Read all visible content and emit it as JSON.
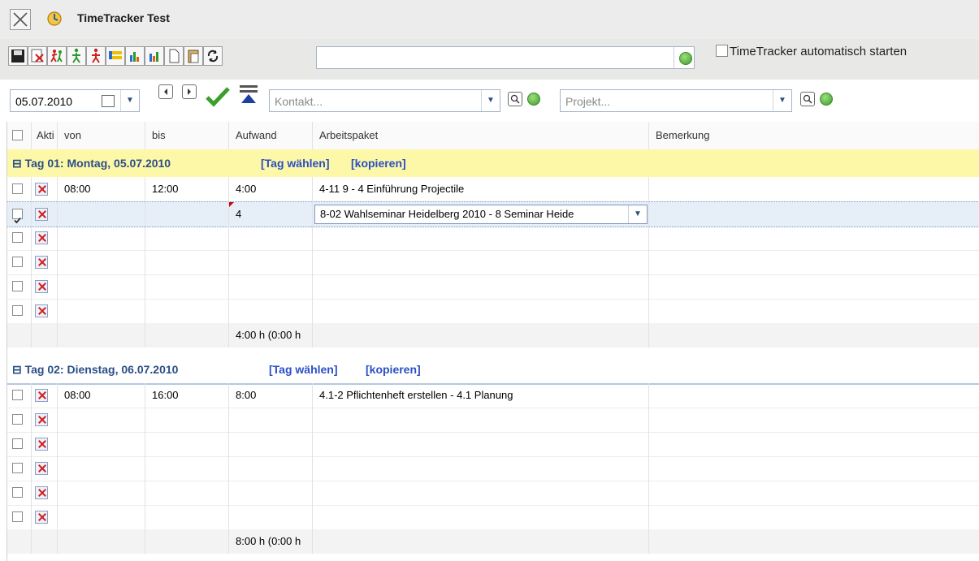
{
  "window": {
    "title": "TimeTracker Test"
  },
  "toolbar": {
    "icons": [
      "save-icon",
      "delete-icon",
      "run-icon",
      "walk-green-icon",
      "walk-red-icon",
      "list-icon",
      "chart1-icon",
      "chart2-icon",
      "new-doc-icon",
      "paste-icon",
      "refresh-icon"
    ],
    "main_select_value": "",
    "autostart_label": "TimeTracker automatisch starten",
    "autostart_checked": false
  },
  "filters": {
    "date": "05.07.2010",
    "contact_placeholder": "Kontakt...",
    "project_placeholder": "Projekt..."
  },
  "grid": {
    "columns": [
      "Akti",
      "von",
      "bis",
      "Aufwand",
      "Arbeitspaket",
      "Bemerkung"
    ],
    "groups": [
      {
        "label": "⊟ Tag 01: Montag, 05.07.2010",
        "select_action": "[Tag wählen]",
        "copy_action": "[kopieren]",
        "rows": [
          {
            "checked": false,
            "von": "08:00",
            "bis": "12:00",
            "aufwand": "4:00",
            "arbeitspaket": "4-11 9 - 4 Einführung Projectile",
            "bemerkung": ""
          },
          {
            "checked": true,
            "von": "",
            "bis": "",
            "aufwand": "4",
            "arbeitspaket": "8-02 Wahlseminar Heidelberg 2010 -  8 Seminar Heide",
            "bemerkung": "",
            "editing": true
          },
          {
            "checked": false,
            "von": "",
            "bis": "",
            "aufwand": "",
            "arbeitspaket": "",
            "bemerkung": ""
          },
          {
            "checked": false,
            "von": "",
            "bis": "",
            "aufwand": "",
            "arbeitspaket": "",
            "bemerkung": ""
          },
          {
            "checked": false,
            "von": "",
            "bis": "",
            "aufwand": "",
            "arbeitspaket": "",
            "bemerkung": ""
          },
          {
            "checked": false,
            "von": "",
            "bis": "",
            "aufwand": "",
            "arbeitspaket": "",
            "bemerkung": ""
          }
        ],
        "summary": "4:00 h (0:00 h"
      },
      {
        "label": "⊟ Tag 02: Dienstag, 06.07.2010",
        "select_action": "[Tag wählen]",
        "copy_action": "[kopieren]",
        "rows": [
          {
            "checked": false,
            "von": "08:00",
            "bis": "16:00",
            "aufwand": "8:00",
            "arbeitspaket": "4.1-2 Pflichtenheft erstellen - 4.1 Planung",
            "bemerkung": ""
          },
          {
            "checked": false,
            "von": "",
            "bis": "",
            "aufwand": "",
            "arbeitspaket": "",
            "bemerkung": ""
          },
          {
            "checked": false,
            "von": "",
            "bis": "",
            "aufwand": "",
            "arbeitspaket": "",
            "bemerkung": ""
          },
          {
            "checked": false,
            "von": "",
            "bis": "",
            "aufwand": "",
            "arbeitspaket": "",
            "bemerkung": ""
          },
          {
            "checked": false,
            "von": "",
            "bis": "",
            "aufwand": "",
            "arbeitspaket": "",
            "bemerkung": ""
          },
          {
            "checked": false,
            "von": "",
            "bis": "",
            "aufwand": "",
            "arbeitspaket": "",
            "bemerkung": ""
          }
        ],
        "summary": "8:00 h (0:00 h"
      }
    ]
  },
  "colors": {
    "group1_bg": "#fdf7a8",
    "group_text": "#2b4f86",
    "action_text": "#2a4fc5",
    "selected_row": "#e6eef8"
  }
}
